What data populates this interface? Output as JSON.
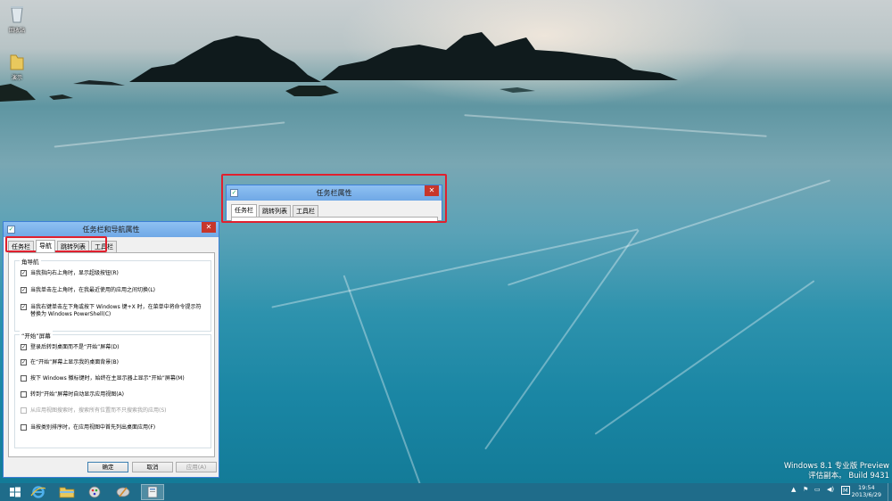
{
  "desktop": {
    "icons": [
      {
        "label": "回收站",
        "icon": "recycle-bin-icon"
      },
      {
        "label": "演示",
        "icon": "folder-icon"
      }
    ],
    "watermark": {
      "line1": "Windows 8.1 专业版 Preview",
      "line2": "评估副本。 Build 9431"
    }
  },
  "small_dialog": {
    "title": "任务栏属性",
    "tabs": [
      "任务栏",
      "跳转列表",
      "工具栏"
    ]
  },
  "main_dialog": {
    "title": "任务栏和导航属性",
    "tabs": [
      "任务栏",
      "导航",
      "跳转列表",
      "工具栏"
    ],
    "active_tab_index": 1,
    "corner_group": {
      "title": "角导航",
      "options": [
        {
          "label": "当我指向右上角时，显示超级按钮(R)",
          "checked": true
        },
        {
          "label": "当我单击左上角时，在我最近使用的应用之间切换(L)",
          "checked": true
        },
        {
          "label": "当我右键单击左下角或按下 Windows 键+X 时，在菜单中将命令提示符替换为 Windows PowerShell(C)",
          "checked": true
        }
      ]
    },
    "start_group": {
      "title": "“开始”屏幕",
      "options": [
        {
          "label": "登录后转到桌面而不是“开始”屏幕(D)",
          "checked": true,
          "disabled": false
        },
        {
          "label": "在“开始”屏幕上显示我的桌面背景(B)",
          "checked": true,
          "disabled": false
        },
        {
          "label": "按下 Windows 徽标键时，始终在主显示器上显示“开始”屏幕(M)",
          "checked": false,
          "disabled": false
        },
        {
          "label": "转到“开始”屏幕时自动显示应用视图(A)",
          "checked": false,
          "disabled": false
        },
        {
          "label": "从应用视图搜索时，搜索所有位置而不只搜索我的应用(S)",
          "checked": false,
          "disabled": true
        },
        {
          "label": "当按类别排序时，在应用视图中首先列出桌面应用(F)",
          "checked": false,
          "disabled": false
        }
      ]
    },
    "buttons": {
      "ok": "确定",
      "cancel": "取消",
      "apply": "应用(A)"
    }
  },
  "taskbar": {
    "items": [
      "start-button",
      "internet-explorer-icon",
      "file-explorer-icon",
      "paint-icon",
      "paint-brush-icon",
      "taskbar-properties-icon"
    ],
    "active_item_index": 5,
    "tray_ime": "M",
    "time": "19:54",
    "date": "2013/6/29"
  },
  "colors": {
    "highlight": "#e0202e",
    "taskbar": "#1f6c8a",
    "titlebar": "#6fa8e6",
    "close": "#c7362b"
  }
}
